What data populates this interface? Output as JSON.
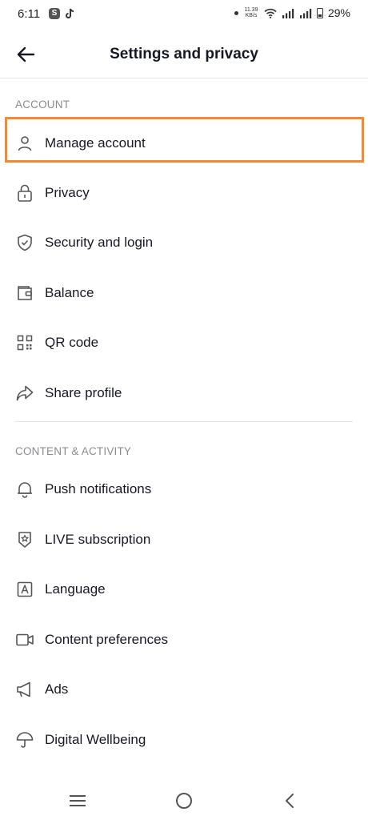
{
  "status_bar": {
    "time": "6:11",
    "speed_value": "11.39",
    "speed_unit": "KB/s",
    "battery": "29%"
  },
  "header": {
    "title": "Settings and privacy",
    "back_icon": "arrow-left-icon"
  },
  "sections": {
    "account": {
      "title": "ACCOUNT",
      "items": [
        {
          "label": "Manage account",
          "icon": "person-icon",
          "highlighted": true
        },
        {
          "label": "Privacy",
          "icon": "lock-icon"
        },
        {
          "label": "Security and login",
          "icon": "shield-check-icon"
        },
        {
          "label": "Balance",
          "icon": "wallet-icon"
        },
        {
          "label": "QR code",
          "icon": "qr-code-icon"
        },
        {
          "label": "Share profile",
          "icon": "share-arrow-icon"
        }
      ]
    },
    "content_activity": {
      "title": "CONTENT & ACTIVITY",
      "items": [
        {
          "label": "Push notifications",
          "icon": "bell-icon"
        },
        {
          "label": "LIVE subscription",
          "icon": "live-badge-icon"
        },
        {
          "label": "Language",
          "icon": "language-icon"
        },
        {
          "label": "Content preferences",
          "icon": "video-camera-icon"
        },
        {
          "label": "Ads",
          "icon": "megaphone-icon"
        },
        {
          "label": "Digital Wellbeing",
          "icon": "umbrella-icon"
        }
      ]
    }
  },
  "nav_bar": {
    "icons": [
      "recents-icon",
      "home-icon",
      "back-icon"
    ]
  },
  "colors": {
    "highlight": "#f08a35",
    "text": "#161823",
    "section_header": "#8a8b91"
  }
}
